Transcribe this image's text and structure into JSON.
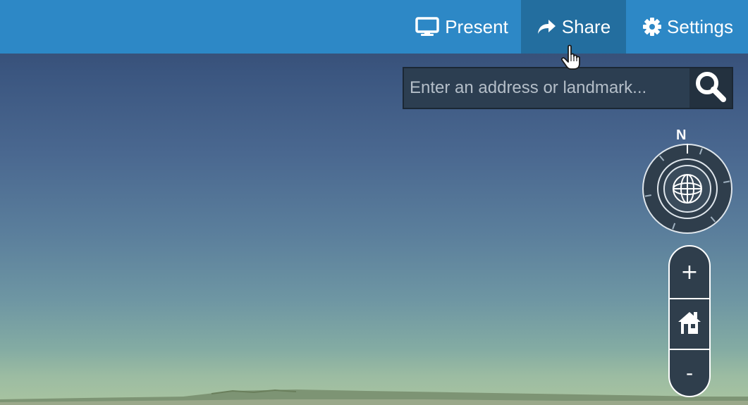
{
  "toolbar": {
    "present": {
      "label": "Present",
      "icon": "monitor-icon"
    },
    "share": {
      "label": "Share",
      "icon": "share-arrow-icon",
      "state": "hover"
    },
    "settings": {
      "label": "Settings",
      "icon": "gear-icon"
    }
  },
  "search": {
    "placeholder": "Enter an address or landmark...",
    "value": "",
    "icon": "search-icon"
  },
  "compass": {
    "north_label": "N",
    "icon": "globe-icon"
  },
  "zoom": {
    "in_label": "+",
    "out_label": "-",
    "home_icon": "home-icon"
  },
  "colors": {
    "toolbar": "#2d88c6",
    "toolbar_hover": "#236e9f",
    "control_bg": "#2f3e4c"
  }
}
